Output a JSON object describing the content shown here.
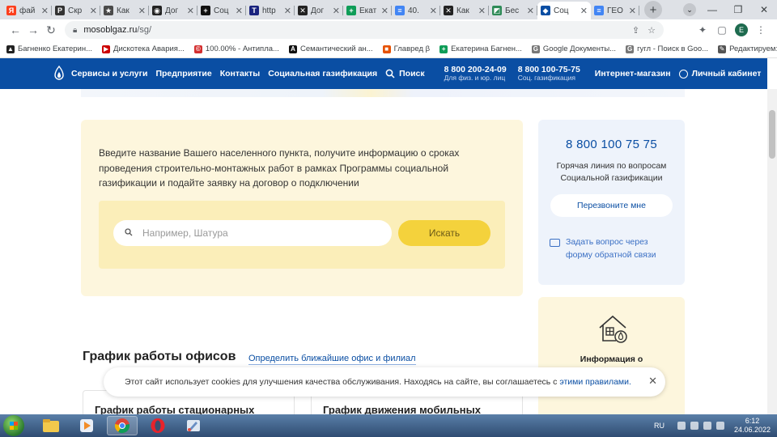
{
  "browser": {
    "tabs": [
      {
        "label": "фай",
        "color": "#fc3f1d",
        "glyph": "Я"
      },
      {
        "label": "Скр",
        "color": "#333333",
        "glyph": "P"
      },
      {
        "label": "Как",
        "color": "#4a4a4a",
        "glyph": "★"
      },
      {
        "label": "Дог",
        "color": "#222222",
        "glyph": "◉"
      },
      {
        "label": "Соц",
        "color": "#111111",
        "glyph": "+"
      },
      {
        "label": "http",
        "color": "#1a237e",
        "glyph": "T"
      },
      {
        "label": "Дог",
        "color": "#222222",
        "glyph": "✕"
      },
      {
        "label": "Екат",
        "color": "#0f9d58",
        "glyph": "+"
      },
      {
        "label": "40.",
        "color": "#4285f4",
        "glyph": "≡"
      },
      {
        "label": "Как",
        "color": "#222222",
        "glyph": "✕"
      },
      {
        "label": "Бес",
        "color": "#2e8b57",
        "glyph": "◩"
      },
      {
        "label": "Соц",
        "color": "#0a4ea3",
        "glyph": "◆",
        "active": true
      },
      {
        "label": "ГЕО",
        "color": "#4285f4",
        "glyph": "≡"
      }
    ],
    "url_host": "mosoblgaz.ru",
    "url_path": "/sg/",
    "profile_initial": "E",
    "bookmarks": [
      {
        "label": "Багненко Екатерин...",
        "color": "#222222",
        "glyph": "▲"
      },
      {
        "label": "Дискотека Авария...",
        "color": "#cc0000",
        "glyph": "▶"
      },
      {
        "label": "100.00% - Антипла...",
        "color": "#d32f2f",
        "glyph": "©"
      },
      {
        "label": "Семантический ан...",
        "color": "#111111",
        "glyph": "A"
      },
      {
        "label": "Главред β",
        "color": "#e65100",
        "glyph": "■"
      },
      {
        "label": "Екатерина Багнен...",
        "color": "#0f9d58",
        "glyph": "+"
      },
      {
        "label": "Google Документы...",
        "color": "#777777",
        "glyph": "G"
      },
      {
        "label": "гугл - Поиск в Goo...",
        "color": "#777777",
        "glyph": "G"
      },
      {
        "label": "Редактируем: Испр...",
        "color": "#555555",
        "glyph": "✎"
      }
    ]
  },
  "site": {
    "nav": [
      "Сервисы и услуги",
      "Предприятие",
      "Контакты",
      "Социальная газификация"
    ],
    "search_label": "Поиск",
    "phone1": {
      "number": "8 800 200-24-09",
      "sub": "Для физ. и юр. лиц"
    },
    "phone2": {
      "number": "8 800 100-75-75",
      "sub": "Соц. газификация"
    },
    "shop": "Интернет-магазин",
    "cabinet": "Личный кабинет"
  },
  "main": {
    "intro": "Введите название Вашего населенного пункта, получите информацию о сроках проведения строительно-монтажных работ в рамках Программы социальной газификации и подайте заявку на договор о подключении",
    "search_placeholder": "Например, Шатура",
    "search_button": "Искать",
    "hotline_number": "8 800 100 75 75",
    "hotline_desc": "Горячая линия по вопросам Социальной газификации",
    "callback_button": "Перезвоните мне",
    "ask_link": "Задать вопрос через форму обратной связи",
    "info_text": "Информация о",
    "offices_title": "График работы офисов",
    "offices_link": "Определить ближайшие офис и филиал",
    "card1": "График работы стационарных",
    "card2": "График движения мобильных"
  },
  "cookie": {
    "text": "Этот сайт использует cookies для улучшения качества обслуживания. Находясь на сайте, вы соглашаетесь с",
    "link": "этими правилами."
  },
  "taskbar": {
    "lang": "RU",
    "time": "6:12",
    "date": "24.06.2022"
  }
}
